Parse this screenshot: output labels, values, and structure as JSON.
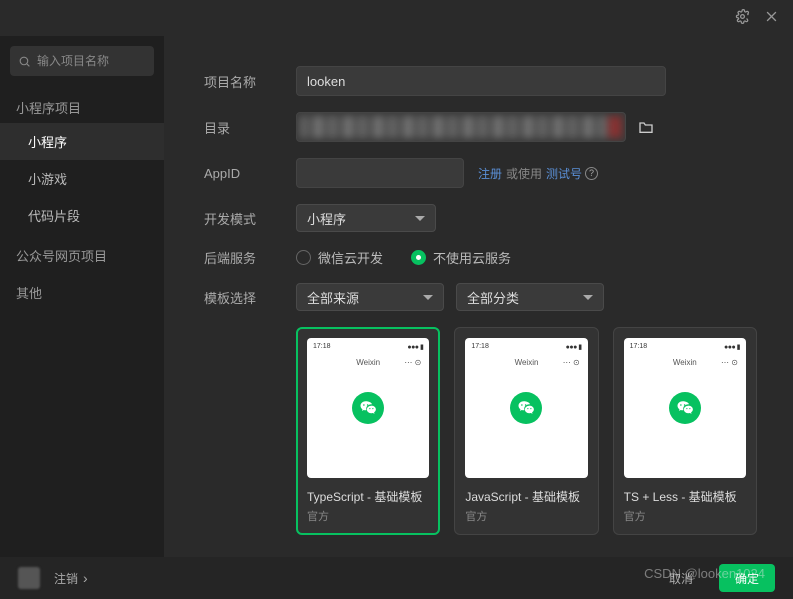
{
  "header": {},
  "search": {
    "placeholder": "输入项目名称"
  },
  "sidebar": {
    "groups": [
      {
        "label": "小程序项目",
        "items": [
          {
            "label": "小程序",
            "active": true
          },
          {
            "label": "小游戏"
          },
          {
            "label": "代码片段"
          }
        ]
      },
      {
        "label": "公众号网页项目",
        "items": []
      },
      {
        "label": "其他",
        "items": []
      }
    ]
  },
  "form": {
    "projectName": {
      "label": "项目名称",
      "value": "looken"
    },
    "directory": {
      "label": "目录"
    },
    "appId": {
      "label": "AppID",
      "value": "",
      "registerLink": "注册",
      "orUse": "或使用",
      "testLink": "测试号"
    },
    "devMode": {
      "label": "开发模式",
      "value": "小程序"
    },
    "backend": {
      "label": "后端服务",
      "options": [
        {
          "label": "微信云开发",
          "checked": false
        },
        {
          "label": "不使用云服务",
          "checked": true
        }
      ]
    },
    "template": {
      "label": "模板选择",
      "source": "全部来源",
      "category": "全部分类"
    }
  },
  "templates": [
    {
      "title": "TypeScript - 基础模板",
      "sub": "官方",
      "selected": true
    },
    {
      "title": "JavaScript - 基础模板",
      "sub": "官方",
      "selected": false
    },
    {
      "title": "TS + Less - 基础模板",
      "sub": "官方",
      "selected": false
    }
  ],
  "footer": {
    "logout": "注销",
    "cancel": "取消",
    "confirm": "确定"
  },
  "watermark": "CSDN @looken1024"
}
